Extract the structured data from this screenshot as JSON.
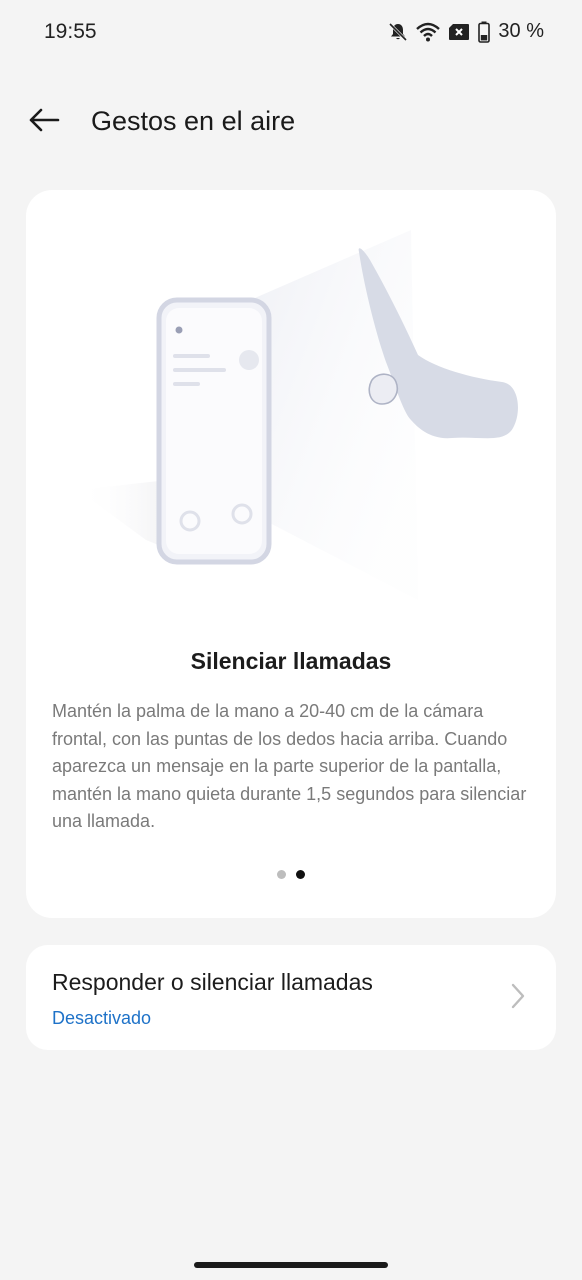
{
  "status_bar": {
    "time": "19:55",
    "battery": "30 %",
    "icons": [
      "mute-bell-icon",
      "wifi-icon",
      "sim-off-icon",
      "battery-icon"
    ]
  },
  "app_bar": {
    "title": "Gestos en el aire",
    "back_icon": "back-arrow-icon"
  },
  "demo_card": {
    "title": "Silenciar llamadas",
    "description": "Mantén la palma de la mano a 20-40 cm de la cámara frontal, con las puntas de los dedos hacia arriba. Cuando aparezca un mensaje en la parte superior de la pantalla, mantén la mano quieta durante 1,5 segundos para silenciar una llamada.",
    "pages": 2,
    "active_page": 2
  },
  "setting": {
    "title": "Responder o silenciar llamadas",
    "status": "Desactivado",
    "status_color": "#1e72c8"
  }
}
